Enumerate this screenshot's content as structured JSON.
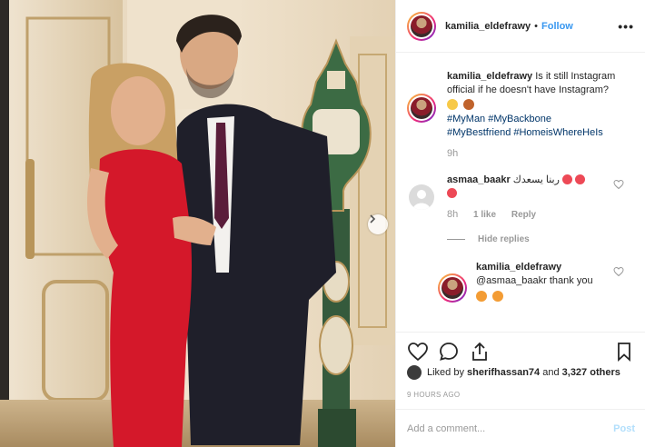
{
  "header": {
    "username": "kamilia_eldefrawy",
    "separator": "•",
    "follow_label": "Follow",
    "more_label": "•••"
  },
  "caption": {
    "username": "kamilia_eldefrawy",
    "text": "Is it still Instagram official if he doesn't have Instagram?",
    "hashtags": [
      "#MyMan",
      "#MyBackbone",
      "#MyBestfriend",
      "#HomeisWhereHeIs"
    ],
    "time": "9h"
  },
  "comments": [
    {
      "username": "asmaa_baakr",
      "text": "ربنا يسعدك",
      "time": "8h",
      "likes": "1 like",
      "reply_label": "Reply"
    }
  ],
  "hide_replies_label": "Hide replies",
  "reply": {
    "username": "kamilia_eldefrawy",
    "text": "@asmaa_baakr thank you"
  },
  "likes": {
    "prefix": "Liked by",
    "user": "sherifhassan74",
    "middle": "and",
    "count": "3,327 others"
  },
  "timestamp": "9 HOURS AGO",
  "add_comment": {
    "placeholder": "Add a comment...",
    "post_label": "Post"
  },
  "colors": {
    "link": "#3897f0",
    "hashtag": "#003569",
    "muted": "#999999",
    "post_disabled": "#b2dffc",
    "heart_red": "#ed4956"
  },
  "icons": [
    "heart-icon",
    "comment-icon",
    "share-icon",
    "bookmark-icon",
    "chevron-right-icon",
    "more-icon"
  ]
}
